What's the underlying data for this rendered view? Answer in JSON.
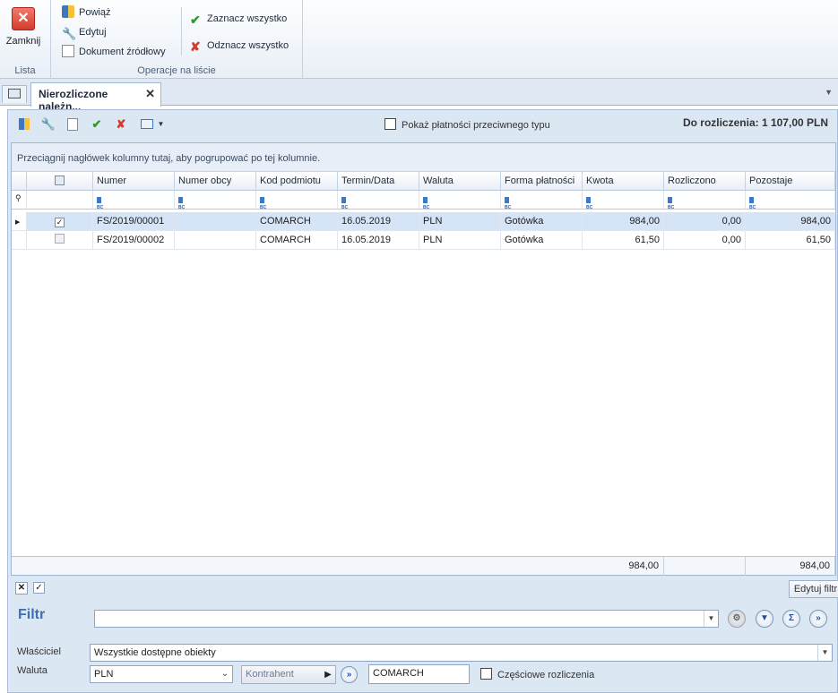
{
  "ribbon": {
    "close_label": "Zamknij",
    "group_list_label": "Lista",
    "group_ops_label": "Operacje na liście",
    "link_label": "Powiąż",
    "edit_label": "Edytuj",
    "source_doc_label": "Dokument źródłowy",
    "select_all_label": "Zaznacz wszystko",
    "deselect_all_label": "Odznacz wszystko"
  },
  "tabs": {
    "active_label": "Nierozliczone należn..."
  },
  "toolbar": {
    "show_opposite_label": "Pokaż płatności przeciwnego typu",
    "to_settle_label": "Do rozliczenia: 1 107,00 PLN"
  },
  "grid": {
    "group_hint": "Przeciągnij nagłówek kolumny tutaj, aby pogrupować po tej kolumnie.",
    "columns": [
      "Numer",
      "Numer obcy",
      "Kod podmiotu",
      "Termin/Data",
      "Waluta",
      "Forma płatności",
      "Kwota",
      "Rozliczono",
      "Pozostaje"
    ],
    "rows": [
      {
        "checked": true,
        "numer": "FS/2019/00001",
        "numer_obcy": "",
        "kod": "COMARCH",
        "termin": "16.05.2019",
        "waluta": "PLN",
        "forma": "Gotówka",
        "kwota": "984,00",
        "rozliczono": "0,00",
        "pozostaje": "984,00"
      },
      {
        "checked": false,
        "numer": "FS/2019/00002",
        "numer_obcy": "",
        "kod": "COMARCH",
        "termin": "16.05.2019",
        "waluta": "PLN",
        "forma": "Gotówka",
        "kwota": "61,50",
        "rozliczono": "0,00",
        "pozostaje": "61,50"
      }
    ],
    "footer": {
      "kwota": "984,00",
      "pozostaje": "984,00"
    }
  },
  "filterbar": {
    "edit_filter_label": "Edytuj filtr"
  },
  "filter": {
    "title": "Filtr",
    "filter_value": "",
    "owner_label": "Właściciel",
    "owner_value": "Wszystkie dostępne obiekty",
    "currency_label": "Waluta",
    "currency_value": "PLN",
    "kontrahent_label": "Kontrahent",
    "kontrahent_value": "COMARCH",
    "partial_label": "Częściowe rozliczenia"
  }
}
